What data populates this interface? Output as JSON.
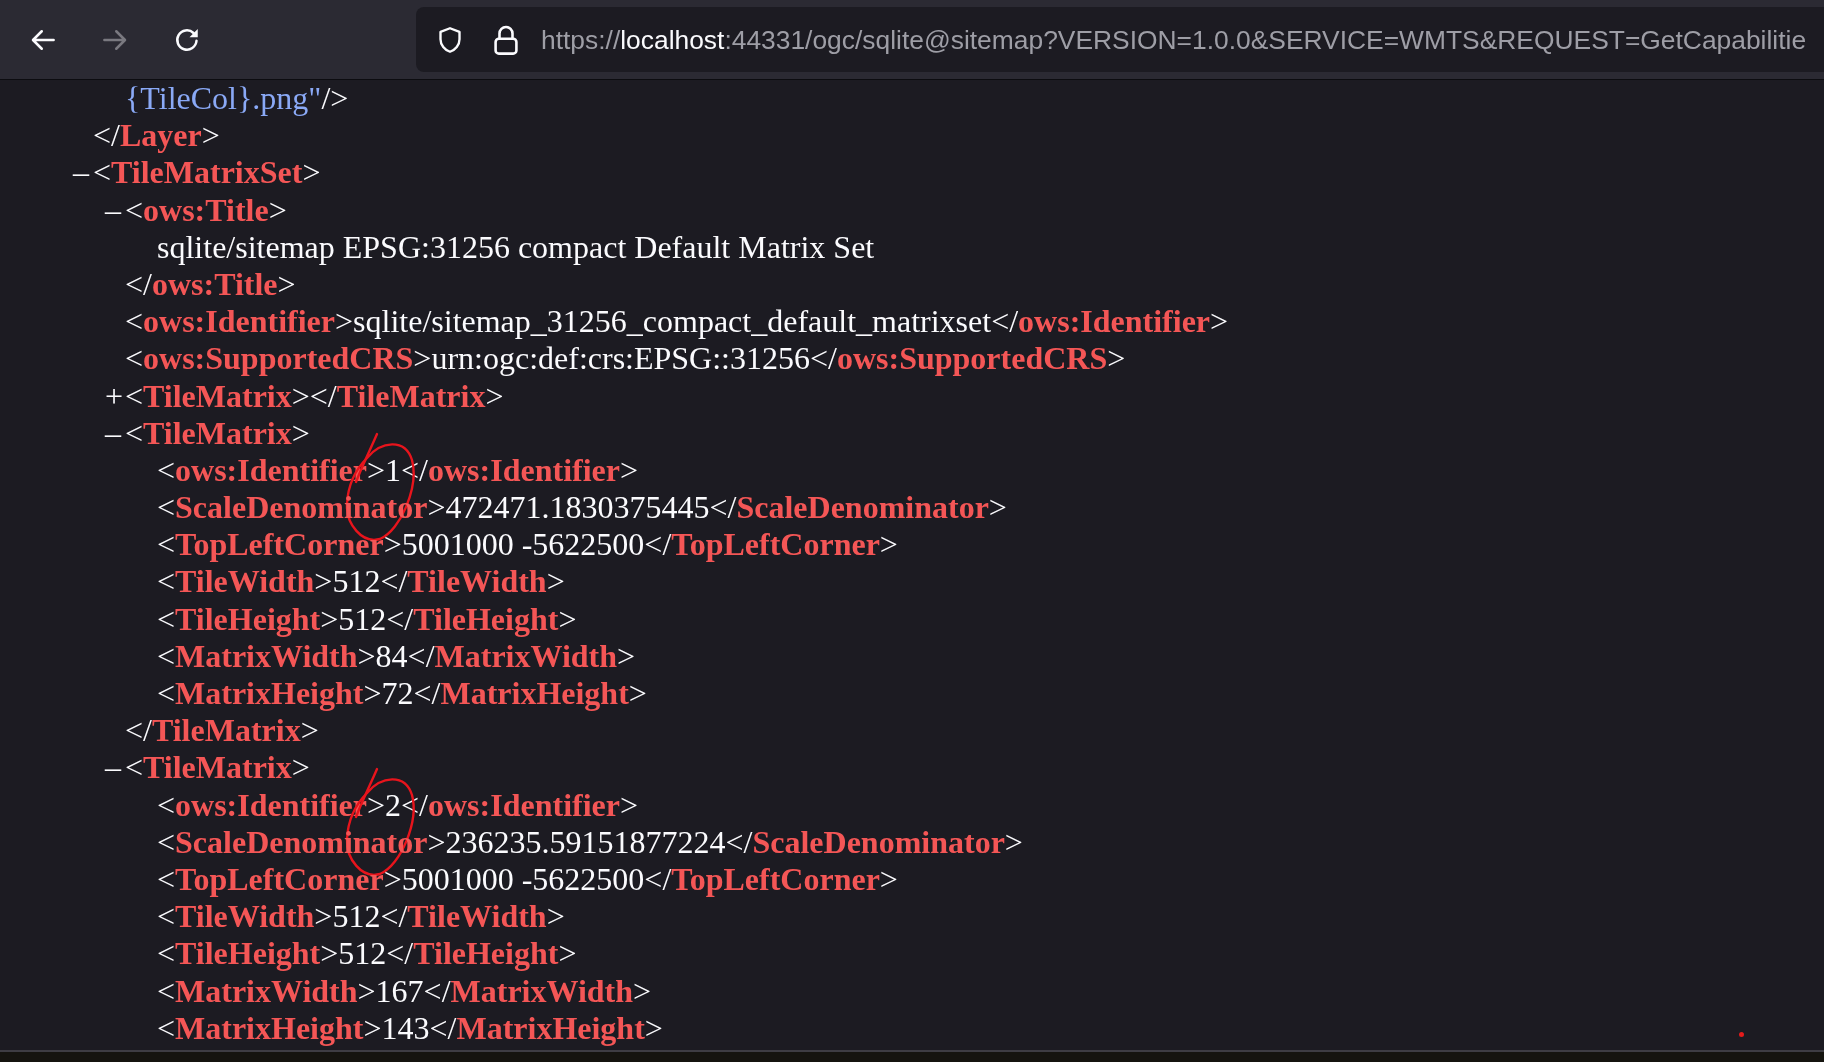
{
  "toolbar": {
    "nav_buttons": [
      {
        "kind": "back",
        "disabled": false
      },
      {
        "kind": "forward",
        "disabled": true
      },
      {
        "kind": "reload",
        "disabled": false
      }
    ],
    "address": {
      "scheme": "https://",
      "host": "localhost",
      "rest": ":44331/ogc/sqlite@sitemap?VERSION=1.0.0&SERVICE=WMTS&REQUEST=GetCapabilitie"
    }
  },
  "document": {
    "nodes": [
      {
        "kind": "element",
        "expanded": true,
        "children": [
          {
            "kind": "continuation",
            "value": "{TileCol}.png\"",
            "end": "/>"
          }
        ],
        "end": "</**Layer**>"
      },
      {
        "kind": "element",
        "toggle": "–",
        "expanded": true,
        "start": "<**TileMatrixSet**>",
        "children": [
          {
            "kind": "element",
            "toggle": "–",
            "expanded": true,
            "start": "<**ows:Title**>",
            "children": [
              {
                "kind": "text",
                "text": "sqlite/sitemap EPSG:31256 compact Default Matrix Set"
              }
            ],
            "end": "</**ows:Title**>"
          },
          {
            "kind": "leaf",
            "open": "<**ows:Identifier**>",
            "value": "sqlite/sitemap_31256_compact_default_matrixset",
            "close": "</**ows:Identifier**>",
            "annotated": false
          },
          {
            "kind": "leaf",
            "open": "<**ows:SupportedCRS**>",
            "value": "urn:ogc:def:crs:EPSG::31256",
            "close": "</**ows:SupportedCRS**>",
            "annotated": false
          },
          {
            "kind": "element",
            "toggle": "+",
            "expanded": false,
            "start": "<**TileMatrix**>",
            "end": "</**TileMatrix**>"
          },
          {
            "kind": "element",
            "toggle": "–",
            "expanded": true,
            "start": "<**TileMatrix**>",
            "children": [
              {
                "kind": "leaf",
                "open": "<**ows:Identifier**>",
                "value": "1",
                "close": "</**ows:Identifier**>",
                "annotated": true
              },
              {
                "kind": "leaf",
                "open": "<**ScaleDenominator**>",
                "value": "472471.1830375445",
                "close": "</**ScaleDenominator**>",
                "annotated": false
              },
              {
                "kind": "leaf",
                "open": "<**TopLeftCorner**>",
                "value": "5001000 -5622500",
                "close": "</**TopLeftCorner**>",
                "annotated": false
              },
              {
                "kind": "leaf",
                "open": "<**TileWidth**>",
                "value": "512",
                "close": "</**TileWidth**>",
                "annotated": false
              },
              {
                "kind": "leaf",
                "open": "<**TileHeight**>",
                "value": "512",
                "close": "</**TileHeight**>",
                "annotated": false
              },
              {
                "kind": "leaf",
                "open": "<**MatrixWidth**>",
                "value": "84",
                "close": "</**MatrixWidth**>",
                "annotated": false
              },
              {
                "kind": "leaf",
                "open": "<**MatrixHeight**>",
                "value": "72",
                "close": "</**MatrixHeight**>",
                "annotated": false
              }
            ],
            "end": "</**TileMatrix**>"
          },
          {
            "kind": "element",
            "toggle": "–",
            "expanded": true,
            "start": "<**TileMatrix**>",
            "children": [
              {
                "kind": "leaf",
                "open": "<**ows:Identifier**>",
                "value": "2",
                "close": "</**ows:Identifier**>",
                "annotated": true
              },
              {
                "kind": "leaf",
                "open": "<**ScaleDenominator**>",
                "value": "236235.59151877224",
                "close": "</**ScaleDenominator**>",
                "annotated": false
              },
              {
                "kind": "leaf",
                "open": "<**TopLeftCorner**>",
                "value": "5001000 -5622500",
                "close": "</**TopLeftCorner**>",
                "annotated": false
              },
              {
                "kind": "leaf",
                "open": "<**TileWidth**>",
                "value": "512",
                "close": "</**TileWidth**>",
                "annotated": false
              },
              {
                "kind": "leaf",
                "open": "<**TileHeight**>",
                "value": "512",
                "close": "</**TileHeight**>",
                "annotated": false
              },
              {
                "kind": "leaf",
                "open": "<**MatrixWidth**>",
                "value": "167",
                "close": "</**MatrixWidth**>",
                "annotated": false
              },
              {
                "kind": "leaf",
                "open": "<**MatrixHeight**>",
                "value": "143",
                "close": "</**MatrixHeight**>",
                "annotated": false
              }
            ]
          }
        ]
      }
    ]
  }
}
